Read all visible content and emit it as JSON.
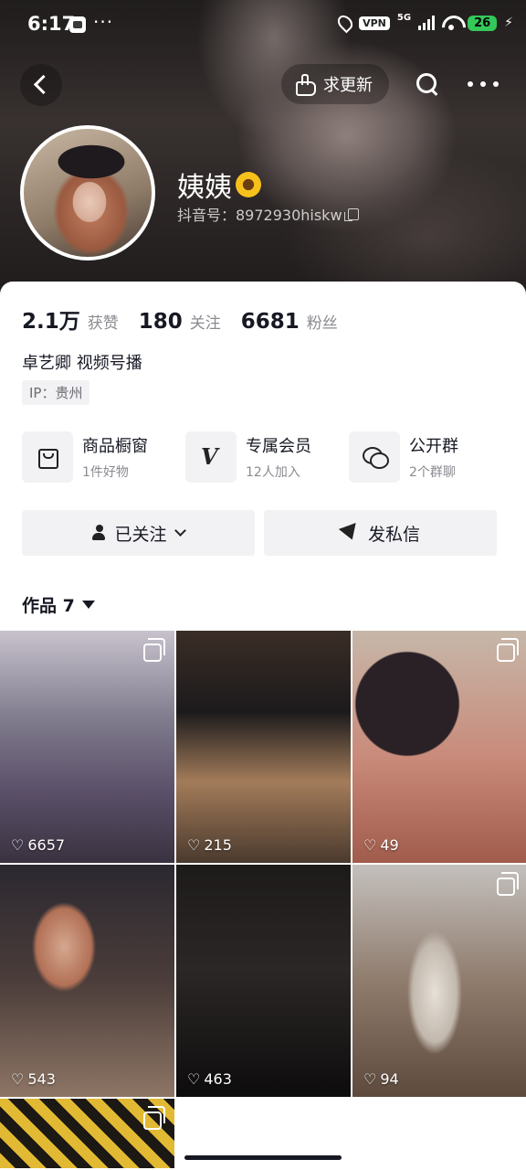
{
  "status_bar": {
    "time": "6:17",
    "dots": "···",
    "vpn": "VPN",
    "network": "5G",
    "battery": "26"
  },
  "nav": {
    "request_update_label": "求更新"
  },
  "profile": {
    "name": "姨姨",
    "douyin_id": "抖音号：8972930hiskw",
    "stats": [
      {
        "num": "2.1万",
        "label": "获赞"
      },
      {
        "num": "180",
        "label": "关注"
      },
      {
        "num": "6681",
        "label": "粉丝"
      }
    ],
    "bio": "卓艺卿  视频号播",
    "ip": "IP：贵州"
  },
  "features": [
    {
      "title": "商品橱窗",
      "sub": "1件好物",
      "icon": "shopping-bag-icon"
    },
    {
      "title": "专属会员",
      "sub": "12人加入",
      "icon": "v-member-icon"
    },
    {
      "title": "公开群",
      "sub": "2个群聊",
      "icon": "group-chat-icon"
    }
  ],
  "actions": {
    "followed_label": "已关注",
    "message_label": "发私信"
  },
  "works": {
    "label": "作品 7"
  },
  "tiles": [
    {
      "likes": "6657",
      "multi": true
    },
    {
      "likes": "215",
      "multi": false
    },
    {
      "likes": "49",
      "multi": true
    },
    {
      "likes": "543",
      "multi": false
    },
    {
      "likes": "463",
      "multi": false
    },
    {
      "likes": "94",
      "multi": true
    },
    {
      "likes": "",
      "multi": true
    }
  ],
  "colors": {
    "accent_battery": "#34c759",
    "text_primary": "#161823",
    "text_secondary": "#8a8b91"
  }
}
